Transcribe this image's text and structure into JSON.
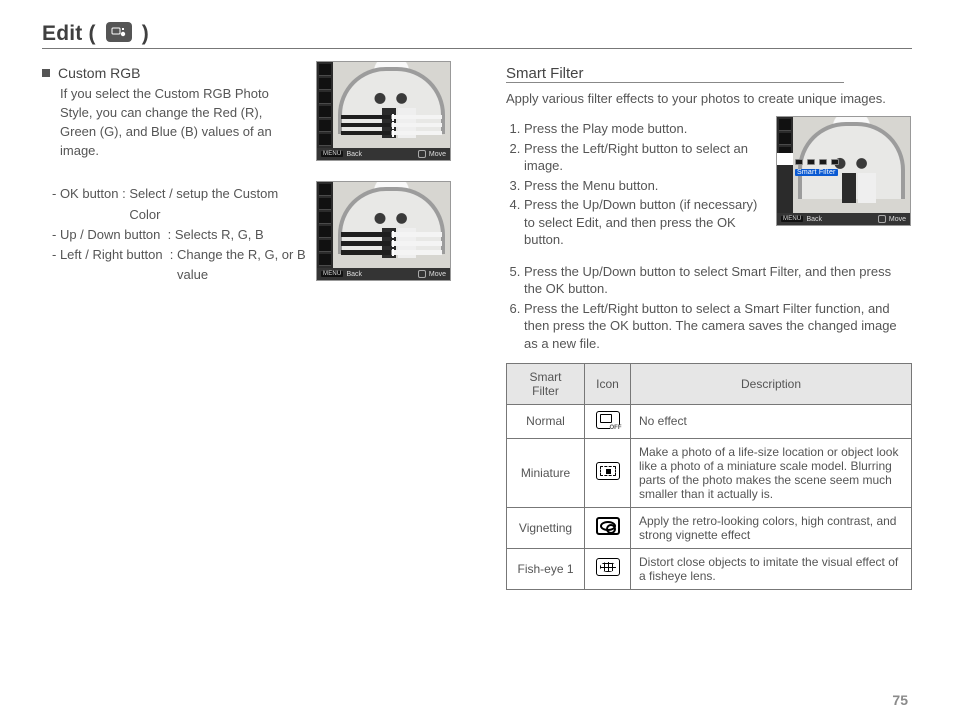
{
  "page_number": "75",
  "title": {
    "prefix": "Edit (",
    "suffix": " )"
  },
  "left": {
    "subhead": "Custom RGB",
    "para": "If you select the Custom RGB Photo Style, you can change the Red (R), Green (G), and Blue (B) values of an image.",
    "controls": [
      {
        "k": "- OK button",
        "sep": " : ",
        "v": "Select / setup the Custom Color"
      },
      {
        "k": "- Up / Down button",
        "sep": "  : ",
        "v": "Selects R, G, B"
      },
      {
        "k": "- Left / Right button",
        "sep": "  : ",
        "v": "Change the R, G, or B value"
      }
    ],
    "lcd_footer": {
      "back_btn": "MENU",
      "back_label": "Back",
      "move_label": "Move"
    }
  },
  "right": {
    "subtitle": "Smart Filter",
    "intro": "Apply various filter effects to your photos to create unique images.",
    "steps": [
      "Press the Play mode button.",
      "Press the Left/Right button to select an image.",
      "Press the Menu button.",
      "Press the Up/Down button (if necessary) to select Edit, and then press the OK button.",
      "Press the Up/Down button to select Smart Filter, and then press the OK button.",
      "Press the Left/Right button to select a Smart Filter function, and then press the OK button. The camera saves the changed image as a new file."
    ],
    "lcd": {
      "caption": "Smart Filter",
      "back_btn": "MENU",
      "back_label": "Back",
      "move_label": "Move"
    },
    "table": {
      "headers": {
        "name": "Smart Filter",
        "icon": "Icon",
        "desc": "Description"
      },
      "rows": [
        {
          "name": "Normal",
          "icon": "off",
          "desc": "No effect"
        },
        {
          "name": "Miniature",
          "icon": "min",
          "desc": "Make a photo of a life-size location or object look like a photo of a miniature scale model. Blurring parts of the photo makes the scene seem much smaller than it actually is."
        },
        {
          "name": "Vignetting",
          "icon": "vig",
          "desc": "Apply the retro-looking colors, high contrast, and strong vignette effect"
        },
        {
          "name": "Fish-eye 1",
          "icon": "fish",
          "desc": "Distort close objects to imitate the visual effect of a fisheye lens."
        }
      ]
    }
  }
}
